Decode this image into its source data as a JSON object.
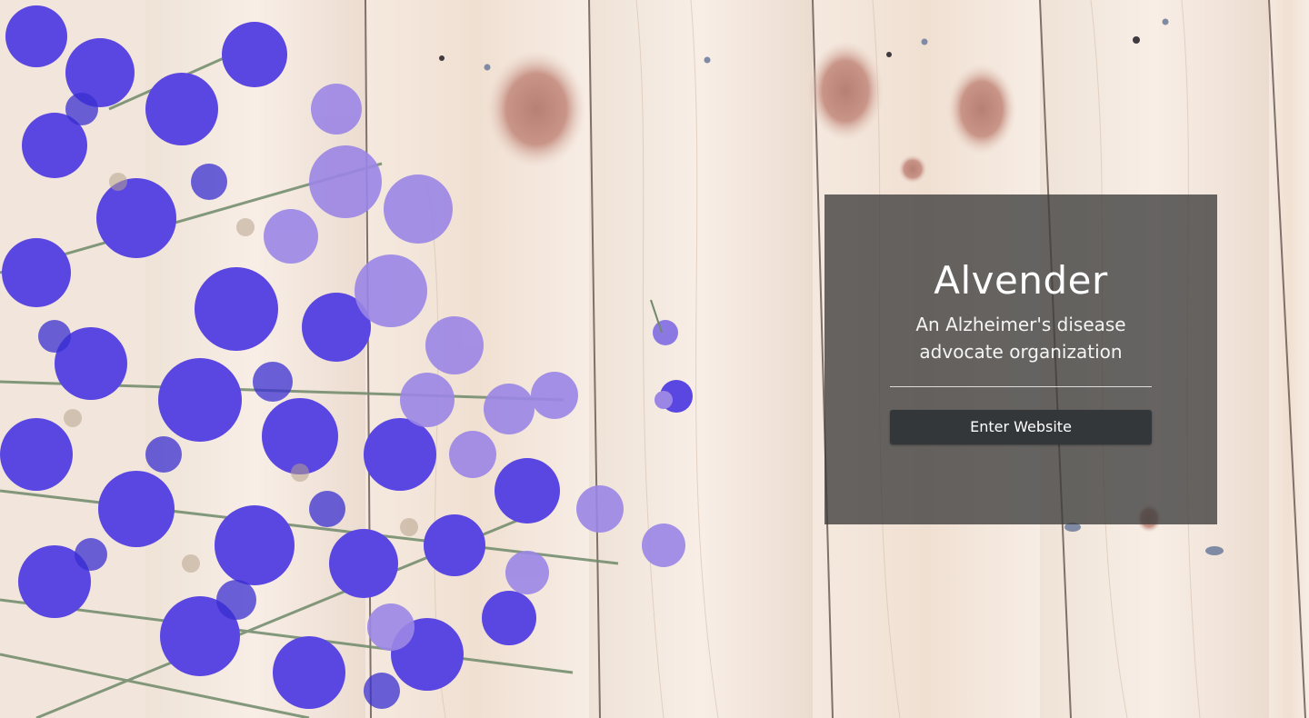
{
  "hero": {
    "background_description_icon": "wood-planks-lavender-flowers-image",
    "panel": {
      "title": "Alvender",
      "subtitle": "An Alzheimer's disease advocate organization",
      "button_label": "Enter Website"
    }
  },
  "colors": {
    "panel_overlay": "#3c3c3c",
    "button_bg": "#33373a",
    "text": "#ffffff",
    "flower_purple": "#6a4be8",
    "wood": "#f2e7dd"
  }
}
